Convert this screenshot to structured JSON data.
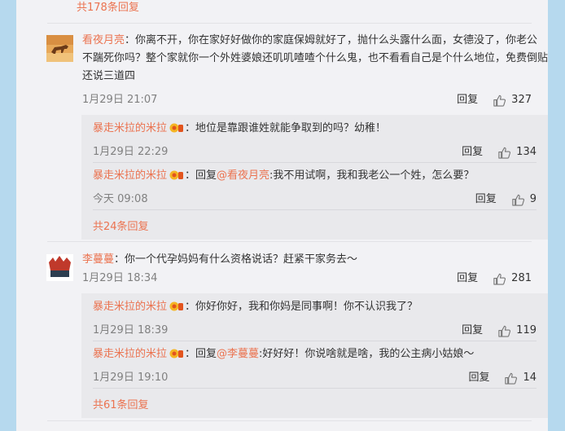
{
  "top": {
    "more_replies": "共178条回复"
  },
  "comments": [
    {
      "user": "看夜月亮",
      "text": "：你离不开，你在家好好做你的家庭保姆就好了，抛什么头露什么面，女德没了，你老公不踹死你吗？整个家就你一个外姓婆娘还叽叽喳喳个什么鬼，也不看看自己是个什么地位，免费倒贴还说三道四",
      "time": "1月29日 21:07",
      "reply_label": "回复",
      "likes": "327",
      "replies": [
        {
          "user": "暴走米拉的米拉",
          "text": "：地位是靠跟谁姓就能争取到的吗？幼稚！",
          "time": "1月29日 22:29",
          "reply_label": "回复",
          "likes": "134"
        },
        {
          "user": "暴走米拉的米拉",
          "prefix": "：回复",
          "mention": "@看夜月亮",
          "text": ":我不用试啊，我和我老公一个姓，怎么要？",
          "time": "今天 09:08",
          "reply_label": "回复",
          "likes": "9"
        }
      ],
      "more_replies": "共24条回复"
    },
    {
      "user": "李蔓蔓",
      "text": "：你一个代孕妈妈有什么资格说话？赶紧干家务去～",
      "time": "1月29日 18:34",
      "reply_label": "回复",
      "likes": "281",
      "replies": [
        {
          "user": "暴走米拉的米拉",
          "text": "：你好你好，我和你妈是同事啊！你不认识我了？",
          "time": "1月29日 18:39",
          "reply_label": "回复",
          "likes": "119"
        },
        {
          "user": "暴走米拉的米拉",
          "prefix": "：回复",
          "mention": "@李蔓蔓",
          "text": ":好好好！你说啥就是啥，我的公主病小姑娘～",
          "time": "1月29日 19:10",
          "reply_label": "回复",
          "likes": "14"
        }
      ],
      "more_replies": "共61条回复"
    }
  ],
  "colors": {
    "accent": "#eb7350",
    "meta": "#808080",
    "panel": "#f2f2f5",
    "reply_bg": "#e9e9ec",
    "page_bg": "#b6d9ee"
  },
  "icons": {
    "like": "thumbs-up-icon",
    "badge": "vip-badge-icon"
  }
}
